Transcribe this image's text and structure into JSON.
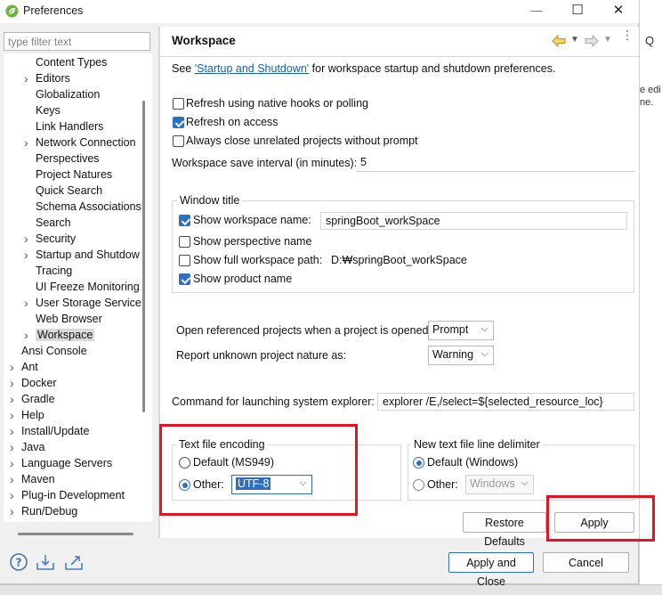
{
  "window": {
    "title": "Preferences",
    "minimize_glyph": "—",
    "maximize_glyph": "☐",
    "close_glyph": "✕"
  },
  "filter": {
    "placeholder": "type filter text"
  },
  "tree": [
    {
      "label": "Content Types",
      "level": 2,
      "expandable": false
    },
    {
      "label": "Editors",
      "level": 2,
      "expandable": true
    },
    {
      "label": "Globalization",
      "level": 2,
      "expandable": false
    },
    {
      "label": "Keys",
      "level": 2,
      "expandable": false
    },
    {
      "label": "Link Handlers",
      "level": 2,
      "expandable": false
    },
    {
      "label": "Network Connection",
      "level": 2,
      "expandable": true
    },
    {
      "label": "Perspectives",
      "level": 2,
      "expandable": false
    },
    {
      "label": "Project Natures",
      "level": 2,
      "expandable": false
    },
    {
      "label": "Quick Search",
      "level": 2,
      "expandable": false
    },
    {
      "label": "Schema Associations",
      "level": 2,
      "expandable": false
    },
    {
      "label": "Search",
      "level": 2,
      "expandable": false
    },
    {
      "label": "Security",
      "level": 2,
      "expandable": true
    },
    {
      "label": "Startup and Shutdow",
      "level": 2,
      "expandable": true
    },
    {
      "label": "Tracing",
      "level": 2,
      "expandable": false
    },
    {
      "label": "UI Freeze Monitoring",
      "level": 2,
      "expandable": false
    },
    {
      "label": "User Storage Service",
      "level": 2,
      "expandable": true
    },
    {
      "label": "Web Browser",
      "level": 2,
      "expandable": false
    },
    {
      "label": "Workspace",
      "level": 2,
      "expandable": true,
      "selected": true
    },
    {
      "label": "Ansi Console",
      "level": 1,
      "expandable": false
    },
    {
      "label": "Ant",
      "level": 1,
      "expandable": true
    },
    {
      "label": "Docker",
      "level": 1,
      "expandable": true
    },
    {
      "label": "Gradle",
      "level": 1,
      "expandable": true
    },
    {
      "label": "Help",
      "level": 1,
      "expandable": true
    },
    {
      "label": "Install/Update",
      "level": 1,
      "expandable": true
    },
    {
      "label": "Java",
      "level": 1,
      "expandable": true
    },
    {
      "label": "Language Servers",
      "level": 1,
      "expandable": true
    },
    {
      "label": "Maven",
      "level": 1,
      "expandable": true
    },
    {
      "label": "Plug-in Development",
      "level": 1,
      "expandable": true
    },
    {
      "label": "Run/Debug",
      "level": 1,
      "expandable": true
    }
  ],
  "page": {
    "title": "Workspace",
    "intro_prefix": "See ",
    "intro_link": "'Startup and Shutdown'",
    "intro_suffix": " for workspace startup and shutdown preferences.",
    "refresh_native": {
      "label": "Refresh using native hooks or polling",
      "checked": false
    },
    "refresh_access": {
      "label": "Refresh on access",
      "checked": true
    },
    "close_unrelated": {
      "label": "Always close unrelated projects without prompt",
      "checked": false
    },
    "save_interval_label": "Workspace save interval (in minutes):",
    "save_interval_value": "5",
    "window_title": {
      "group_label": "Window title",
      "show_workspace_name": {
        "label": "Show workspace name:",
        "checked": true,
        "value": "springBoot_workSpace"
      },
      "show_perspective_name": {
        "label": "Show perspective name",
        "checked": false
      },
      "show_full_path": {
        "label": "Show full workspace path:",
        "checked": false,
        "value": "D:₩springBoot_workSpace"
      },
      "show_product_name": {
        "label": "Show product name",
        "checked": true
      }
    },
    "open_referenced_label": "Open referenced projects when a project is opened:",
    "open_referenced_value": "Prompt",
    "report_unknown_label": "Report unknown project nature as:",
    "report_unknown_value": "Warning",
    "explorer_label": "Command for launching system explorer:",
    "explorer_value": "explorer /E,/select=${selected_resource_loc}",
    "encoding": {
      "group_label": "Text file encoding",
      "default_label": "Default (MS949)",
      "other_label": "Other:",
      "other_value": "UTF-8",
      "selected": "other"
    },
    "line_delimiter": {
      "group_label": "New text file line delimiter",
      "default_label": "Default (Windows)",
      "other_label": "Other:",
      "other_value": "Windows",
      "selected": "default"
    },
    "restore_defaults_label": "Restore Defaults",
    "apply_label": "Apply"
  },
  "footer": {
    "apply_close_label": "Apply and Close",
    "cancel_label": "Cancel"
  },
  "colors": {
    "accent": "#2d6ec7",
    "highlight_box": "#e8131f",
    "link": "#1a5fb4",
    "back_arrow": "#e3a21a"
  },
  "background": {
    "text_line1": "e edi",
    "text_line2": "ne.",
    "search_glyph": "Q"
  }
}
